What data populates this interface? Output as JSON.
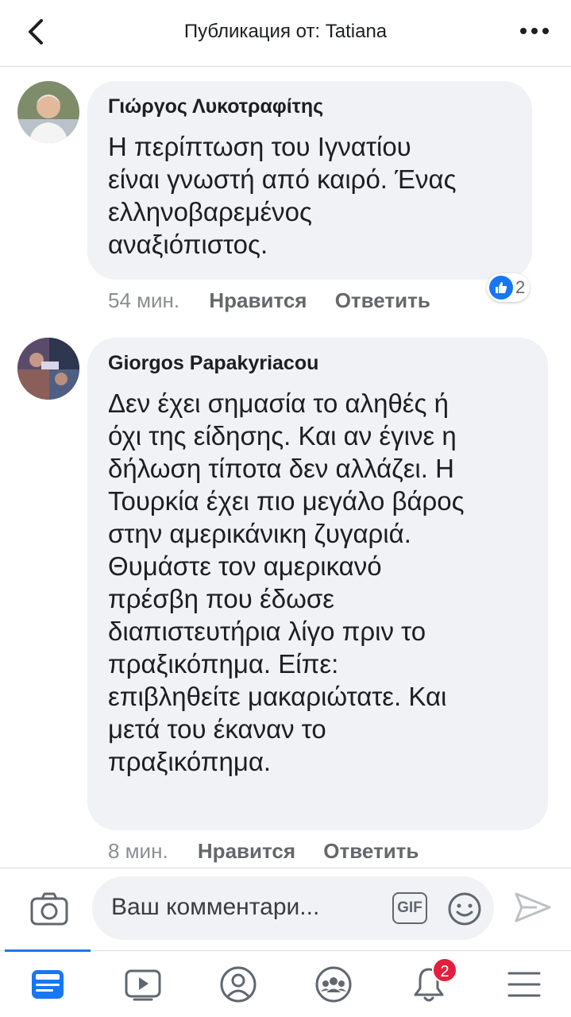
{
  "header": {
    "title": "Публикация от: Tatiana",
    "back_icon": "chevron-left-icon",
    "more_icon": "more-dots-icon"
  },
  "comments": [
    {
      "author": "Γιώργος Λυκοτραφίτης",
      "lines": [
        "Η περίπτωση του Ιγνατίου",
        "είναι γνωστή από καιρό. Ένας",
        "ελληνοβαρεμένος",
        "αναξιόπιστος."
      ],
      "time": "54 мин.",
      "like_label": "Нравится",
      "reply_label": "Ответить",
      "reaction_count": "2",
      "reaction_icon": "thumbs-up-icon"
    },
    {
      "author": "Giorgos Papakyriacou",
      "lines": [
        "Δεν έχει σημασία το αληθές ή",
        "όχι της είδησης. Και αν έγινε η",
        "δήλωση τίποτα δεν αλλάζει. Η",
        "Τουρκία έχει πιο μεγάλο βάρος",
        "στην αμερικάνικη ζυγαριά.",
        "Θυμάστε τον αμερικανό",
        "πρέσβη που έδωσε",
        "διαπιστευτήρια λίγο πριν το",
        "πραξικόπημα. Είπε:",
        "επιβληθείτε μακαριώτατε. Και",
        "μετά του έκαναν το",
        "πραξικόπημα."
      ],
      "time": "8 мин.",
      "like_label": "Нравится",
      "reply_label": "Ответить"
    }
  ],
  "composer": {
    "placeholder": "Ваш комментари...",
    "gif_label": "GIF",
    "camera_icon": "camera-icon",
    "emoji_icon": "smiley-icon",
    "send_icon": "send-icon"
  },
  "tabbar": {
    "items": [
      {
        "name": "news-feed",
        "icon": "news-feed-icon",
        "active": true
      },
      {
        "name": "watch",
        "icon": "video-icon"
      },
      {
        "name": "profile",
        "icon": "profile-icon"
      },
      {
        "name": "groups",
        "icon": "groups-icon"
      },
      {
        "name": "notifications",
        "icon": "bell-icon",
        "badge": "2"
      },
      {
        "name": "menu",
        "icon": "hamburger-menu-icon"
      }
    ]
  },
  "colors": {
    "accent": "#1877f2",
    "bubble": "#f0f2f5",
    "badge": "#e41e3f"
  }
}
